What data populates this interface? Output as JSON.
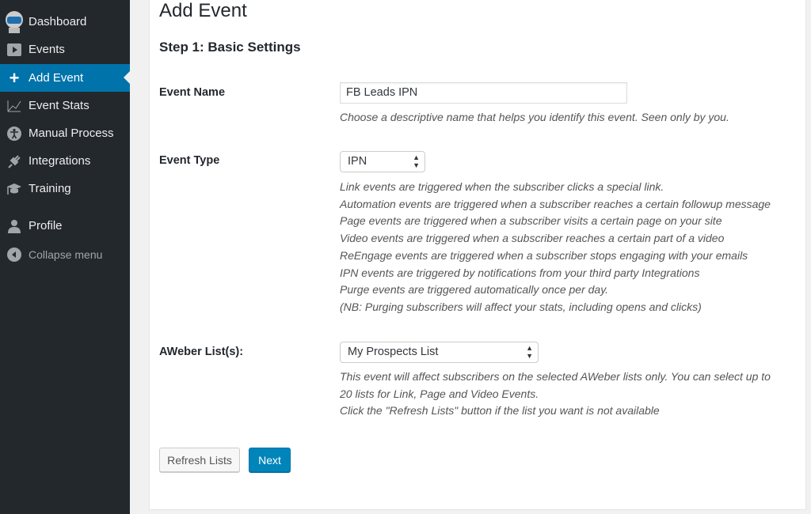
{
  "sidebar": {
    "items": [
      {
        "label": "Dashboard",
        "icon": "robot-logo-icon"
      },
      {
        "label": "Events",
        "icon": "play-icon"
      },
      {
        "label": "Add Event",
        "icon": "plus-icon",
        "active": true
      },
      {
        "label": "Event Stats",
        "icon": "chart-icon"
      },
      {
        "label": "Manual Process",
        "icon": "accessibility-icon"
      },
      {
        "label": "Integrations",
        "icon": "plug-icon"
      },
      {
        "label": "Training",
        "icon": "graduation-cap-icon"
      },
      {
        "label": "Profile",
        "icon": "user-icon"
      },
      {
        "label": "Collapse menu",
        "icon": "collapse-icon"
      }
    ],
    "accent": "#0073aa"
  },
  "page": {
    "title": "Add Event",
    "step": "Step 1: Basic Settings"
  },
  "form": {
    "event_name": {
      "label": "Event Name",
      "value": "FB Leads IPN",
      "help": "Choose a descriptive name that helps you identify this event. Seen only by you."
    },
    "event_type": {
      "label": "Event Type",
      "value": "IPN",
      "help": [
        "Link events are triggered when the subscriber clicks a special link.",
        "Automation events are triggered when a subscriber reaches a certain followup message",
        "Page events are triggered when a subscriber visits a certain page on your site",
        "Video events are triggered when a subscriber reaches a certain part of a video",
        "ReEngage events are triggered when a subscriber stops engaging with your emails",
        "IPN events are triggered by notifications from your third party Integrations",
        "Purge events are triggered automatically once per day.",
        "(NB: Purging subscribers will affect your stats, including opens and clicks)"
      ]
    },
    "aweber_list": {
      "label": "AWeber List(s):",
      "value": "My Prospects List",
      "help": [
        "This event will affect subscribers on the selected AWeber lists only. You can select up to",
        "20 lists for Link, Page and Video Events.",
        "Click the \"Refresh Lists\" button if the list you want is not available"
      ]
    }
  },
  "buttons": {
    "refresh": "Refresh Lists",
    "next": "Next"
  }
}
